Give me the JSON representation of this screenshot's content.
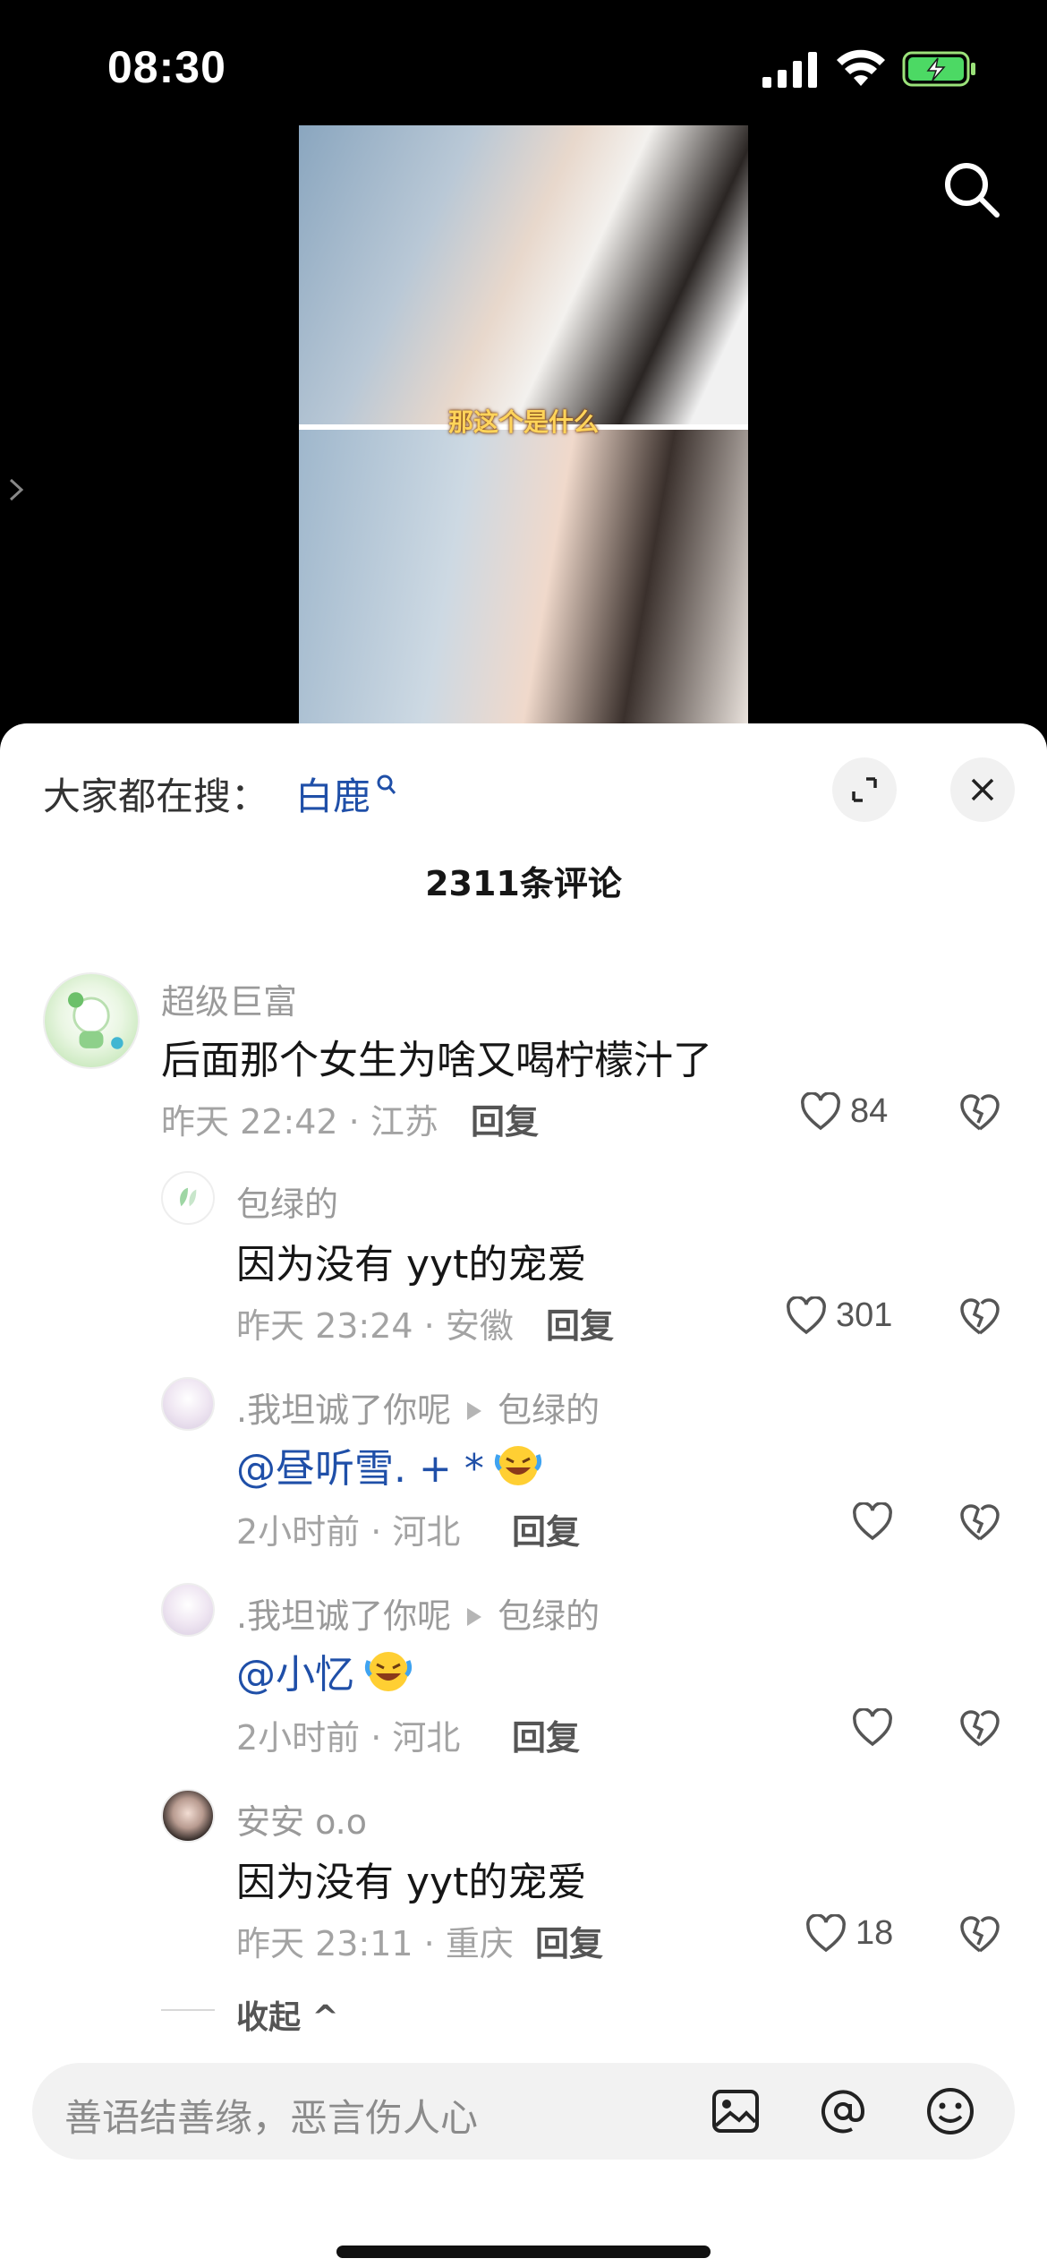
{
  "status_bar": {
    "time": "08:30"
  },
  "video": {
    "subtitle": "那这个是什么"
  },
  "sheet": {
    "search_hint_label": "大家都在搜：",
    "search_term": "白鹿",
    "comment_count": "2311条评论",
    "comments": [
      {
        "username": "超级巨富",
        "content": "后面那个女生为啥又喝柠檬汁了",
        "time_location": "昨天 22:42 · 江苏",
        "reply_label": "回复",
        "likes": "84"
      },
      {
        "username": "包绿的",
        "content": "因为没有 yyt的宠爱",
        "time_location": "昨天 23:24 · 安徽",
        "reply_label": "回复",
        "likes": "301"
      },
      {
        "username": ".我坦诚了你呢",
        "reply_to": "包绿的",
        "mention": "@昼听雪. + *",
        "time_location": "2小时前 · 河北",
        "reply_label": "回复",
        "likes": ""
      },
      {
        "username": ".我坦诚了你呢",
        "reply_to": "包绿的",
        "mention": "@小忆",
        "time_location": "2小时前 · 河北",
        "reply_label": "回复",
        "likes": ""
      },
      {
        "username": "安安 o.o",
        "content": "因为没有 yyt的宠爱",
        "time_location": "昨天 23:11 · 重庆",
        "reply_label": "回复",
        "likes": "18"
      }
    ],
    "collapse_label": "收起 ^",
    "input_placeholder": "善语结善缘，恶言伤人心"
  }
}
